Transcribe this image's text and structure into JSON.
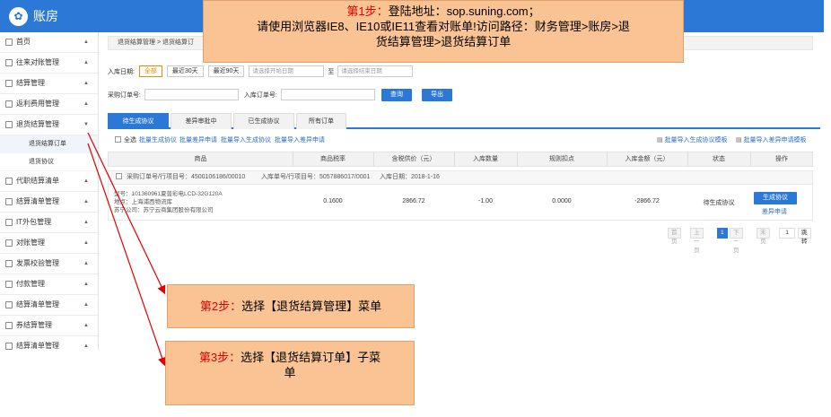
{
  "app": {
    "logo_glyph": "✿",
    "title": "账房"
  },
  "sidebar": {
    "items": [
      {
        "label": "首页",
        "icon": "home-icon"
      },
      {
        "label": "往来对账管理",
        "icon": "ledger-icon"
      },
      {
        "label": "结算管理",
        "icon": "settlement-icon"
      },
      {
        "label": "返利费用管理",
        "icon": "rebate-icon"
      },
      {
        "label": "退货结算管理",
        "icon": "return-icon"
      },
      {
        "label": "代职结算清单",
        "icon": "list-icon"
      },
      {
        "label": "结算清单管理",
        "icon": "list-icon"
      },
      {
        "label": "IT外包管理",
        "icon": "outsourcing-icon"
      },
      {
        "label": "对账管理",
        "icon": "reconcile-icon"
      },
      {
        "label": "发票校验管理",
        "icon": "invoice-icon"
      },
      {
        "label": "付款管理",
        "icon": "payment-icon"
      },
      {
        "label": "结算清单管理",
        "icon": "list-icon"
      },
      {
        "label": "券结算管理",
        "icon": "coupon-icon"
      },
      {
        "label": "结算清单管理",
        "icon": "list-icon"
      }
    ],
    "subitems": [
      {
        "label": "退货结算订单"
      },
      {
        "label": "退货协议"
      }
    ]
  },
  "breadcrumb": {
    "text": "退货结算管理 > 退货结算订"
  },
  "filters": {
    "date_label": "入库日期:",
    "date_buttons": [
      "全部",
      "最近30天",
      "最近90天"
    ],
    "start_placeholder": "请选择开始日期",
    "range_sep": "至",
    "end_placeholder": "请选择结束日期",
    "po_label": "采购订单号:",
    "in_label": "入库订单号:",
    "search_button": "查询",
    "export_button": "导出"
  },
  "tabs": [
    "待生成协议",
    "差异审批中",
    "已生成协议",
    "所有订单"
  ],
  "toolbar": {
    "select_all": "全选",
    "batch_generate": "批量生成协议",
    "batch_diff": "批量差异申请",
    "batch_import_generate": "批量导入生成协议",
    "batch_import_diff": "批量导入差异申请",
    "template_generate": "批量导入生成协议模板",
    "template_diff": "批量导入差异申请模板"
  },
  "table": {
    "columns": [
      "商品",
      "商品税率",
      "含税供价（元）",
      "入库数量",
      "规则扣点",
      "入库金额（元）",
      "状态",
      "操作"
    ],
    "group": {
      "po": "采购订单号/行项目号：4500106186/00010",
      "in_order": "入库单号/行项目号：5057886017/0001",
      "in_date": "入库日期：2018-1-16"
    },
    "row": {
      "goods_line1": "型号：101360961夏普彩电LCD-32G120A",
      "goods_line2": "地点：上海浦西物流库",
      "goods_line3": "苏宁公司：苏宁云商集团股份有限公司",
      "tax_rate": "0.1600",
      "price": "2866.72",
      "qty": "-1.00",
      "deduct": "0.0000",
      "amount": "-2866.72",
      "status": "待生成协议",
      "action_primary": "生成协议",
      "action_secondary": "差异申请"
    }
  },
  "pager": {
    "first": "首页",
    "prev": "上一页",
    "current": "1",
    "next": "下一页",
    "last": "末页",
    "goto_value": "1",
    "goto_button": "跳转"
  },
  "callouts": {
    "step1_label": "第1步：",
    "step1_line1": "登陆地址：sop.suning.com；",
    "step1_line2": "请使用浏览器IE8、IE10或IE11查看对账单!访问路径：财务管理>账房>退",
    "step1_line3": "货结算管理>退货结算订单",
    "step2_label": "第2步：",
    "step2_text": "选择【退货结算管理】菜单",
    "step3_label": "第3步：",
    "step3_line1": "选择【退货结算订单】子菜",
    "step3_line2": "单"
  },
  "colors": {
    "primary": "#2b78d6",
    "callout": "#f9c393",
    "arrow": "#e00000",
    "accent": "#f08a00"
  }
}
